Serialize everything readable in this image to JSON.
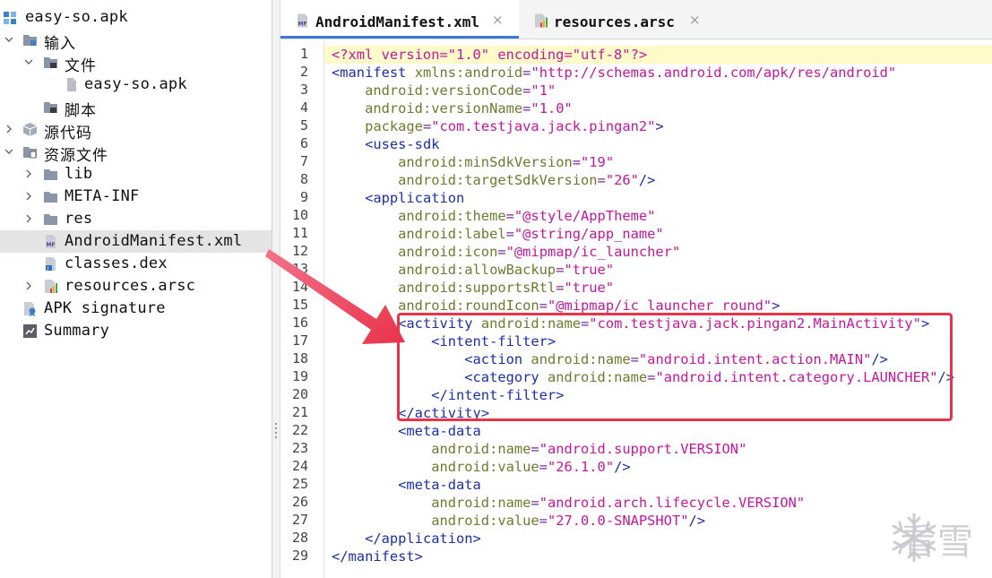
{
  "tree": {
    "items": [
      {
        "label": "easy-so.apk",
        "icon": "apk-icon"
      },
      {
        "label": "输入",
        "icon": "folder-input-icon"
      },
      {
        "label": "文件",
        "icon": "folder-icon"
      },
      {
        "label": "easy-so.apk",
        "icon": "file-icon"
      },
      {
        "label": "脚本",
        "icon": "folder-icon"
      },
      {
        "label": "源代码",
        "icon": "package-icon"
      },
      {
        "label": "资源文件",
        "icon": "folder-icon"
      },
      {
        "label": "lib",
        "icon": "folder-icon"
      },
      {
        "label": "META-INF",
        "icon": "folder-icon"
      },
      {
        "label": "res",
        "icon": "folder-icon"
      },
      {
        "label": "AndroidManifest.xml",
        "icon": "manifest-file-icon"
      },
      {
        "label": "classes.dex",
        "icon": "java-file-icon"
      },
      {
        "label": "resources.arsc",
        "icon": "arsc-file-icon"
      },
      {
        "label": "APK signature",
        "icon": "certificate-icon"
      },
      {
        "label": "Summary",
        "icon": "summary-icon"
      }
    ]
  },
  "tabs": [
    {
      "label": "AndroidManifest.xml",
      "icon": "manifest-file-icon",
      "close": "×"
    },
    {
      "label": "resources.arsc",
      "icon": "arsc-file-icon",
      "close": "×"
    }
  ],
  "editor": {
    "line_numbers": [
      "1",
      "2",
      "3",
      "4",
      "5",
      "6",
      "7",
      "8",
      "9",
      "10",
      "11",
      "12",
      "13",
      "14",
      "15",
      "16",
      "17",
      "18",
      "19",
      "20",
      "21",
      "22",
      "23",
      "24",
      "25",
      "26",
      "27",
      "28",
      "29"
    ],
    "lines": [
      "<?xml version=\"1.0\" encoding=\"utf-8\"?>",
      "<manifest xmlns:android=\"http://schemas.android.com/apk/res/android\"",
      "    android:versionCode=\"1\"",
      "    android:versionName=\"1.0\"",
      "    package=\"com.testjava.jack.pingan2\">",
      "    <uses-sdk",
      "        android:minSdkVersion=\"19\"",
      "        android:targetSdkVersion=\"26\"/>",
      "    <application",
      "        android:theme=\"@style/AppTheme\"",
      "        android:label=\"@string/app_name\"",
      "        android:icon=\"@mipmap/ic_launcher\"",
      "        android:allowBackup=\"true\"",
      "        android:supportsRtl=\"true\"",
      "        android:roundIcon=\"@mipmap/ic_launcher_round\">",
      "        <activity android:name=\"com.testjava.jack.pingan2.MainActivity\">",
      "            <intent-filter>",
      "                <action android:name=\"android.intent.action.MAIN\"/>",
      "                <category android:name=\"android.intent.category.LAUNCHER\"/>",
      "            </intent-filter>",
      "        </activity>",
      "        <meta-data",
      "            android:name=\"android.support.VERSION\"",
      "            android:value=\"26.1.0\"/>",
      "        <meta-data",
      "            android:name=\"android.arch.lifecycle.VERSION\"",
      "            android:value=\"27.0.0-SNAPSHOT\"/>",
      "    </application>",
      "</manifest>"
    ]
  },
  "watermark": {
    "text": "看雪",
    "icon": "snowflake-icon"
  },
  "colors": {
    "tag": "#1a2fa8",
    "attribute": "#6e7a2e",
    "value": "#c4169e",
    "current_line": "#fffbc8",
    "annotation": "#e8334a",
    "tab_accent": "#3d78d8",
    "selection": "#e4e4e4"
  }
}
